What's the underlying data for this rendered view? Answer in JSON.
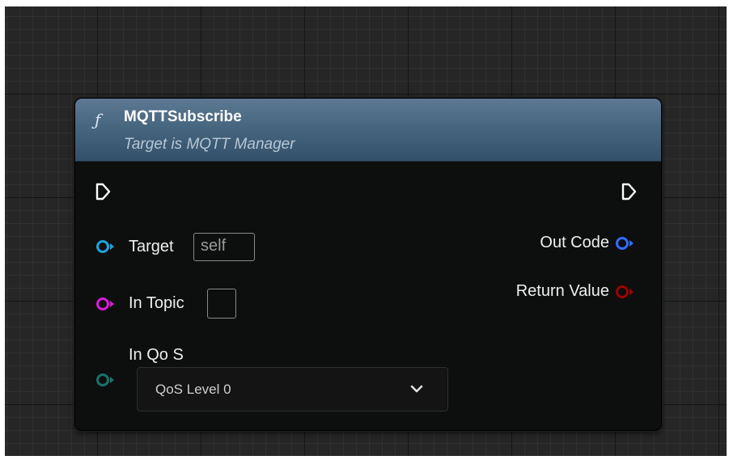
{
  "node": {
    "icon": "function-icon",
    "icon_glyph": "ƒ",
    "title": "MQTTSubscribe",
    "subtitle": "Target is MQTT Manager"
  },
  "pins": {
    "target_label": "Target",
    "target_default": "self",
    "in_topic_label": "In Topic",
    "in_topic_value": "",
    "in_qos_label": "In Qo S",
    "qos_selected": "QoS Level 0",
    "out_code_label": "Out Code",
    "return_value_label": "Return Value"
  },
  "colors": {
    "header_top": "#5d7995",
    "header_bottom": "#34506a",
    "object_pin": "#1da3dd",
    "string_pin": "#d91bd6",
    "byte_pin": "#17736a",
    "int_pin": "#2f6cff",
    "bool_pin": "#9e0000",
    "exec_pin": "#ffffff"
  }
}
